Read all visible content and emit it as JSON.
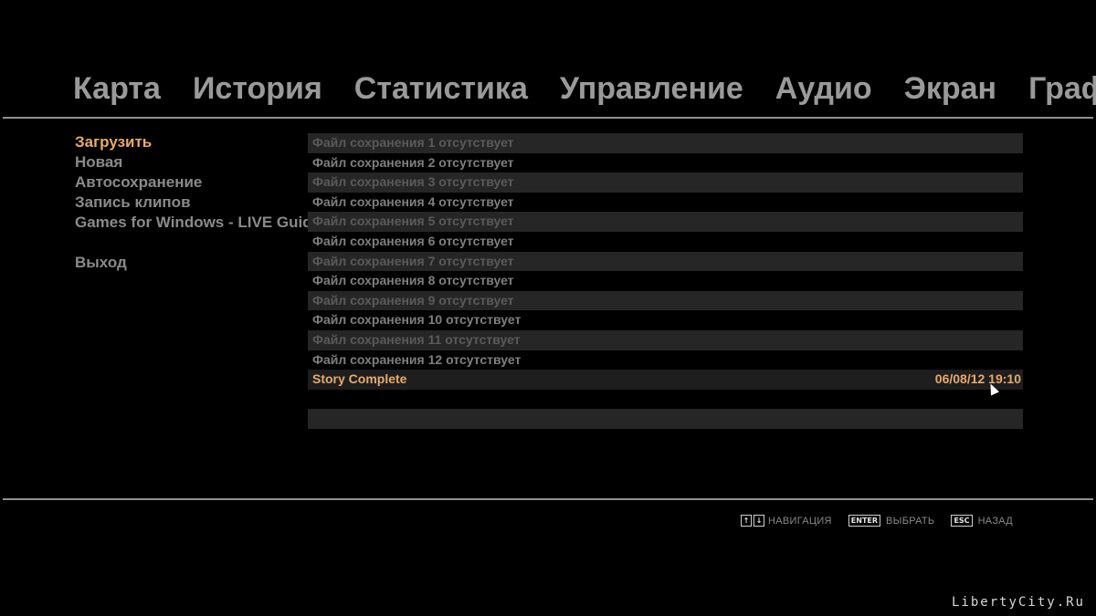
{
  "tabs": [
    "Карта",
    "История",
    "Статистика",
    "Управление",
    "Аудио",
    "Экран",
    "Граф"
  ],
  "left_menu": {
    "items": [
      "Загрузить",
      "Новая",
      "Автосохранение",
      "Запись клипов",
      "Games for Windows - LIVE Guide"
    ],
    "exit": "Выход"
  },
  "slots": [
    "Файл сохранения 1 отсутствует",
    "Файл сохранения 2 отсутствует",
    "Файл сохранения 3 отсутствует",
    "Файл сохранения 4 отсутствует",
    "Файл сохранения 5 отсутствует",
    "Файл сохранения 6 отсутствует",
    "Файл сохранения 7 отсутствует",
    "Файл сохранения 8 отсутствует",
    "Файл сохранения 9 отсутствует",
    "Файл сохранения 10 отсутствует",
    "Файл сохранения 11 отсутствует",
    "Файл сохранения 12 отсутствует"
  ],
  "story_slot": {
    "label": "Story Complete",
    "date": "06/08/12 19:10"
  },
  "hints": {
    "up_key": "↑",
    "down_key": "↓",
    "navigate": "НАВИГАЦИЯ",
    "enter_key": "ENTER",
    "select": "ВЫБРАТЬ",
    "esc_key": "ESC",
    "back": "НАЗАД"
  },
  "watermark": "LibertyCity.Ru",
  "colors": {
    "accent": "#e8a96a",
    "text": "#8a8a8a",
    "background": "#000000"
  }
}
